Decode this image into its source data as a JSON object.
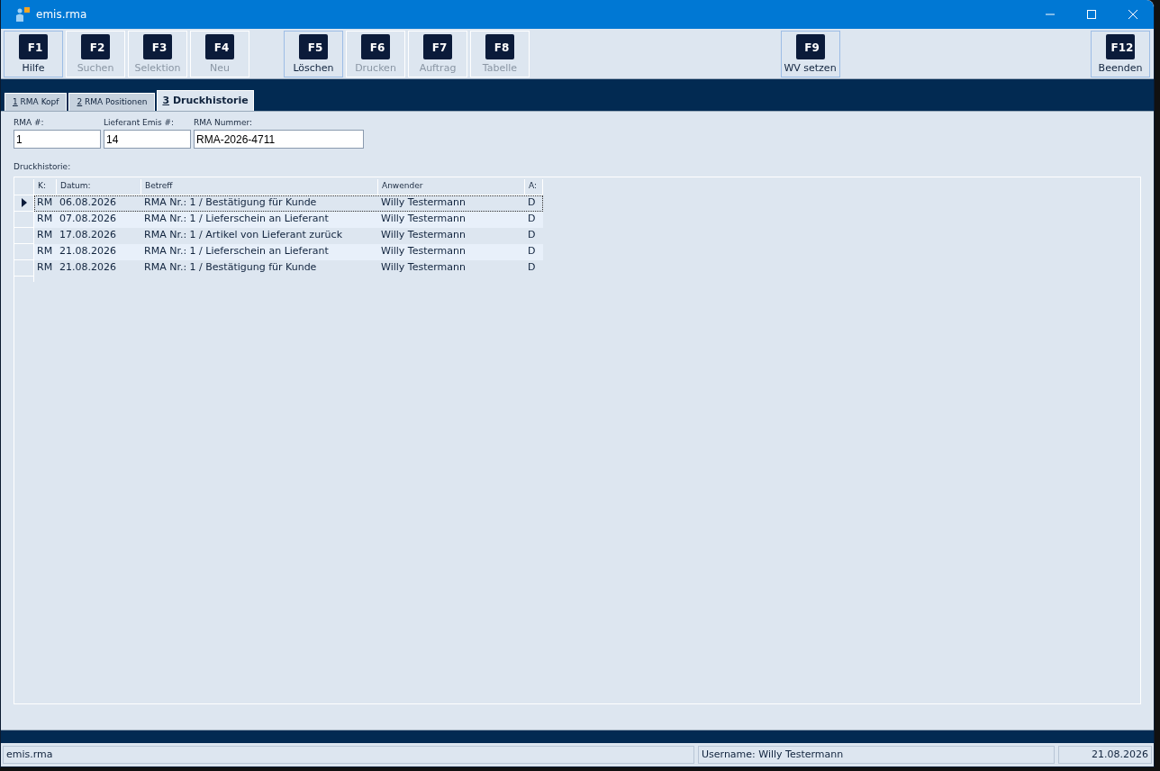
{
  "window": {
    "title": "emis.rma"
  },
  "toolbar": [
    {
      "key": "F1",
      "label": "Hilfe",
      "disabled": false
    },
    {
      "key": "F2",
      "label": "Suchen",
      "disabled": true
    },
    {
      "key": "F3",
      "label": "Selektion",
      "disabled": true
    },
    {
      "key": "F4",
      "label": "Neu",
      "disabled": true
    },
    {
      "key": "F5",
      "label": "Löschen",
      "disabled": false
    },
    {
      "key": "F6",
      "label": "Drucken",
      "disabled": true
    },
    {
      "key": "F7",
      "label": "Auftrag",
      "disabled": true
    },
    {
      "key": "F8",
      "label": "Tabelle",
      "disabled": true
    },
    {
      "key": "F9",
      "label": "WV setzen",
      "disabled": false
    },
    {
      "key": "F12",
      "label": "Beenden",
      "disabled": false
    }
  ],
  "tabs": [
    {
      "key": "1",
      "label": "RMA Kopf",
      "selected": false
    },
    {
      "key": "2",
      "label": "RMA Positionen",
      "selected": false
    },
    {
      "key": "3",
      "label": "Druckhistorie",
      "selected": true
    }
  ],
  "fields": [
    {
      "label": "RMA #:",
      "value": "1"
    },
    {
      "label": "Lieferant Emis #:",
      "value": "14"
    },
    {
      "label": "RMA Nummer:",
      "value": "RMA-2026-4711"
    }
  ],
  "table": {
    "title": "Druckhistorie:",
    "columns": [
      "K:",
      "Datum:",
      "Betreff",
      "Anwender",
      "A:"
    ],
    "rows": [
      {
        "cells": [
          "RM",
          "06.08.2026",
          "RMA Nr.: 1 / Bestätigung für Kunde",
          "Willy Testermann",
          "D"
        ],
        "selected": true
      },
      {
        "cells": [
          "RM",
          "07.08.2026",
          "RMA Nr.: 1 / Lieferschein an Lieferant",
          "Willy Testermann",
          "D"
        ],
        "selected": false
      },
      {
        "cells": [
          "RM",
          "17.08.2026",
          "RMA Nr.: 1 / Artikel von Lieferant zurück",
          "Willy Testermann",
          "D"
        ],
        "selected": false
      },
      {
        "cells": [
          "RM",
          "21.08.2026",
          "RMA Nr.: 1 / Lieferschein an Lieferant",
          "Willy Testermann",
          "D"
        ],
        "selected": false
      },
      {
        "cells": [
          "RM",
          "21.08.2026",
          "RMA Nr.: 1 / Bestätigung für Kunde",
          "Willy Testermann",
          "D"
        ],
        "selected": false
      }
    ]
  },
  "status_bar": {
    "app": "emis.rma",
    "user": "Username: Willy Testermann",
    "date": "21.08.2026"
  }
}
